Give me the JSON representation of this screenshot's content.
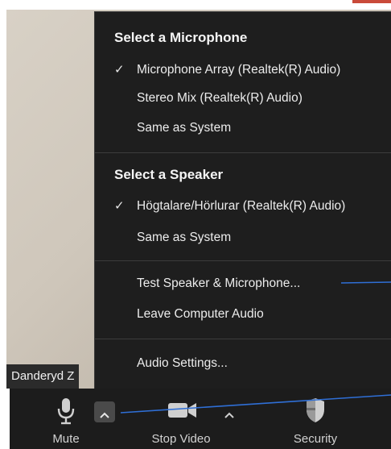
{
  "participant_name": "Danderyd Z",
  "audio_menu": {
    "microphone_heading": "Select a Microphone",
    "microphones": [
      {
        "label": "Microphone Array (Realtek(R) Audio)",
        "checked": true
      },
      {
        "label": "Stereo Mix (Realtek(R) Audio)",
        "checked": false
      },
      {
        "label": "Same as System",
        "checked": false
      }
    ],
    "speaker_heading": "Select a Speaker",
    "speakers": [
      {
        "label": "Högtalare/Hörlurar (Realtek(R) Audio)",
        "checked": true
      },
      {
        "label": "Same as System",
        "checked": false
      }
    ],
    "check_mark": "✓",
    "test_label": "Test Speaker & Microphone...",
    "leave_label": "Leave Computer Audio",
    "settings_label": "Audio Settings..."
  },
  "toolbar": {
    "mute_label": "Mute",
    "stop_video_label": "Stop Video",
    "security_label": "Security"
  },
  "icons": {
    "mic": "microphone-icon",
    "video": "video-camera-icon",
    "security": "shield-icon",
    "caret": "chevron-up-icon"
  },
  "colors": {
    "menu_bg": "#1e1e1e",
    "toolbar_bg": "#1c1c1c",
    "annotation_line": "#2f6fd6"
  }
}
